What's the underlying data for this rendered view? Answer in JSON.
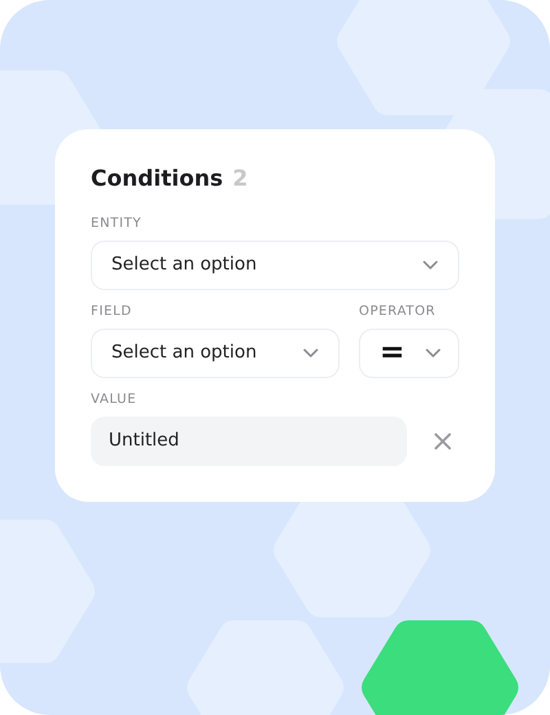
{
  "card": {
    "title": "Conditions",
    "count": "2"
  },
  "rows": [
    [
      {
        "kind": "select",
        "label": "ENTITY",
        "value": "Select an option"
      }
    ],
    [
      {
        "kind": "select",
        "label": "FIELD",
        "value": "Select an option"
      },
      {
        "kind": "operator",
        "label": "OPERATOR",
        "operator": "="
      }
    ],
    [
      {
        "kind": "text",
        "label": "VALUE",
        "value": "Untitled",
        "clearable": true
      }
    ]
  ]
}
